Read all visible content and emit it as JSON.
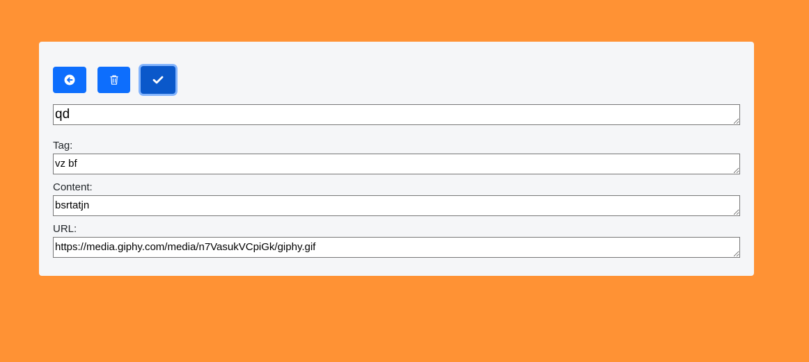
{
  "toolbar": {
    "back_icon": "arrow-circle-left-icon",
    "delete_icon": "trash-icon",
    "save_icon": "check-icon"
  },
  "form": {
    "title_value": "qd",
    "tag_label": "Tag:",
    "tag_value": "vz bf",
    "content_label": "Content:",
    "content_value": "bsrtatjn",
    "url_label": "URL:",
    "url_value": "https://media.giphy.com/media/n7VasukVCpiGk/giphy.gif"
  },
  "colors": {
    "background": "#ff9234",
    "card": "#f5f6f8",
    "primary_button": "#0d6efd",
    "active_button": "#0a58ca"
  }
}
